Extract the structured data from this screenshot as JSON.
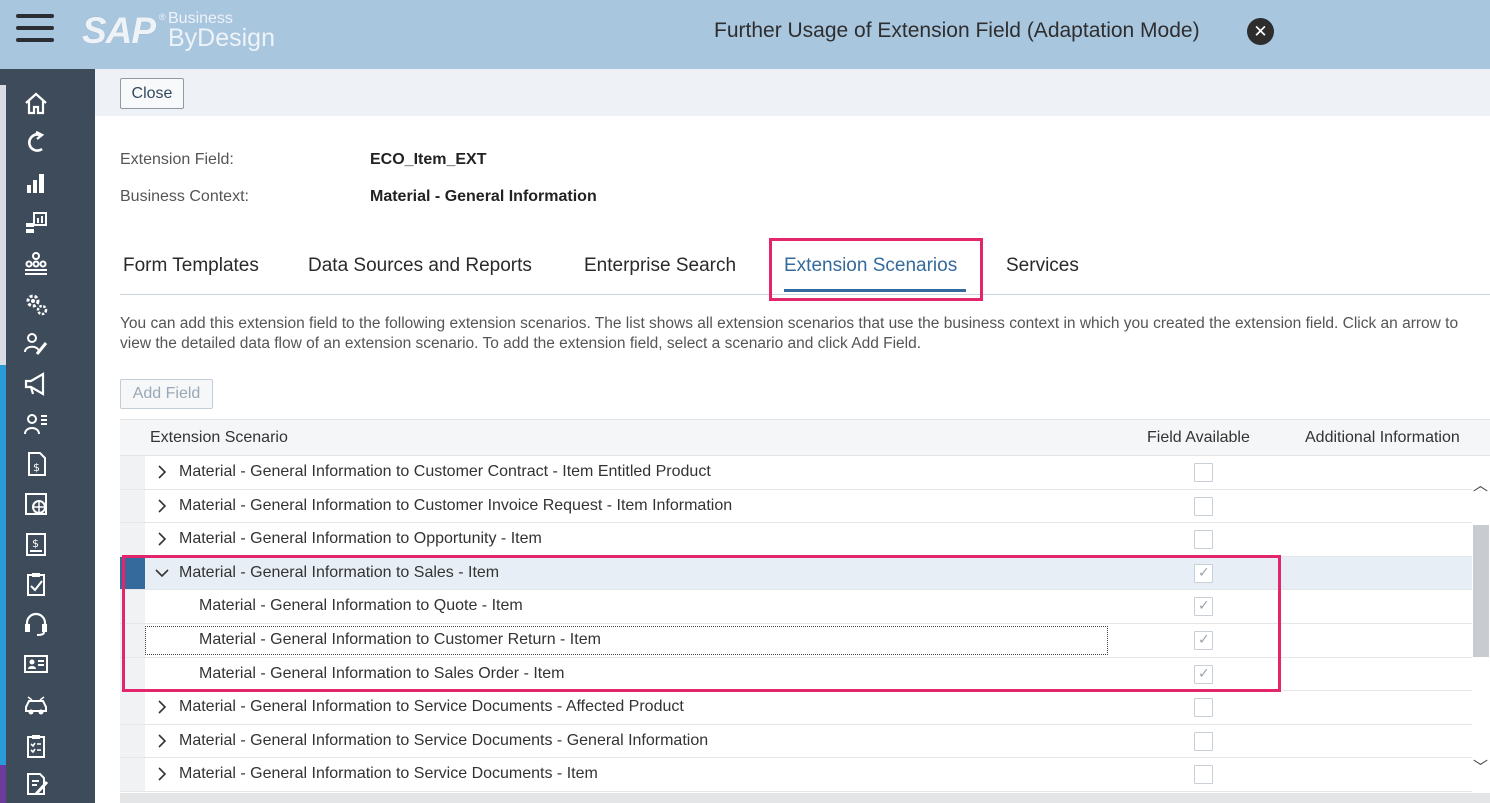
{
  "header": {
    "logo_sap": "SAP",
    "logo_business": "Business",
    "logo_bydesign": "ByDesign",
    "title": "Further Usage of Extension Field (Adaptation Mode)",
    "close_icon": "✕"
  },
  "sidebar": {
    "icons": [
      "home-icon",
      "refresh-icon",
      "bar-chart-icon",
      "analytics-icon",
      "org-chart-icon",
      "settings-icon",
      "user-edit-icon",
      "megaphone-icon",
      "user-list-icon",
      "invoice-icon",
      "globe-calendar-icon",
      "billing-icon",
      "clipboard-icon",
      "headset-icon",
      "id-card-icon",
      "car-icon",
      "checklist-icon",
      "edit-document-icon"
    ]
  },
  "toolbar": {
    "close_label": "Close"
  },
  "details": {
    "field_label": "Extension Field:",
    "field_value": "ECO_Item_EXT",
    "context_label": "Business Context:",
    "context_value": "Material - General Information"
  },
  "tabs": [
    {
      "label": "Form Templates"
    },
    {
      "label": "Data Sources and Reports"
    },
    {
      "label": "Enterprise Search"
    },
    {
      "label": "Extension Scenarios"
    },
    {
      "label": "Services"
    }
  ],
  "description": "You can add this extension field to the following extension scenarios. The list shows all extension scenarios that use the business context in which you created the extension field. Click an arrow to view the detailed data flow of an extension scenario. To add the extension field, select a scenario and click Add Field.",
  "add_field_label": "Add Field",
  "table": {
    "columns": [
      "Extension Scenario",
      "Field Available",
      "Additional Information"
    ],
    "rows": [
      {
        "label": "Material - General Information to Customer Contract - Item Entitled Product",
        "expand": "collapsed",
        "checked": false
      },
      {
        "label": "Material - General Information to Customer Invoice Request - Item Information",
        "expand": "collapsed",
        "checked": false
      },
      {
        "label": "Material - General Information to Opportunity - Item",
        "expand": "collapsed",
        "checked": false
      },
      {
        "label": "Material - General Information to Sales - Item",
        "expand": "expanded",
        "checked": true,
        "selected": true
      },
      {
        "label": "Material - General Information to Quote - Item",
        "expand": "child",
        "checked": true
      },
      {
        "label": "Material - General Information to Customer Return - Item",
        "expand": "child",
        "checked": true,
        "focused": true
      },
      {
        "label": "Material - General Information to Sales Order - Item",
        "expand": "child",
        "checked": true
      },
      {
        "label": "Material - General Information to Service Documents - Affected Product",
        "expand": "collapsed",
        "checked": false
      },
      {
        "label": "Material - General Information to Service Documents - General Information",
        "expand": "collapsed",
        "checked": false
      },
      {
        "label": "Material - General Information to Service Documents - Item",
        "expand": "collapsed",
        "checked": false
      }
    ]
  },
  "colors": {
    "highlight": "#e3266c",
    "accent": "#346a9c",
    "header_bg": "#a9c6df",
    "sidebar_bg": "#3e4b5a"
  }
}
